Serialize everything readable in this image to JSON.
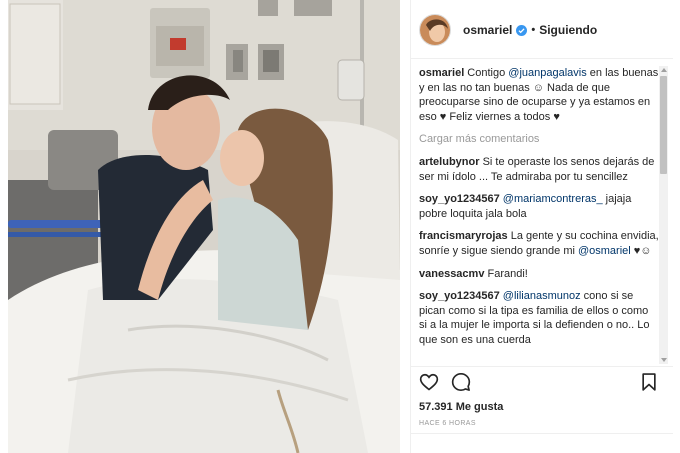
{
  "post": {
    "username": "osmariel",
    "verified": true,
    "separator": "•",
    "follow_state": "Siguiendo",
    "likes": "57.391 Me gusta",
    "time_ago": "HACE 6 HORAS"
  },
  "caption": {
    "user": "osmariel",
    "text_1": " Contigo ",
    "mention": "@juanpagalavis",
    "text_2": " en las buenas y en las no tan buenas ☺ Nada de que preocuparse sino de ocuparse y ya estamos en eso ♥ Feliz viernes a todos ♥"
  },
  "load_more": "Cargar más comentarios",
  "comments": [
    {
      "user": "artelubynor",
      "text": " Si te operaste los senos dejarás de ser mi ídolo ... Te admiraba por tu sencillez",
      "mention": "",
      "after": ""
    },
    {
      "user": "soy_yo1234567",
      "text": " ",
      "mention": "@mariamcontreras_",
      "after": " jajaja pobre loquita jala bola"
    },
    {
      "user": "francismaryrojas",
      "text": " La gente y su cochina envidia, sonríe y sigue siendo grande mi ",
      "mention": "@osmariel",
      "after": " ♥☺"
    },
    {
      "user": "vanessacmv",
      "text": " Farandi!",
      "mention": "",
      "after": ""
    },
    {
      "user": "soy_yo1234567",
      "text": " ",
      "mention": "@lilianasmunoz",
      "after": " cono si se pican como si la tipa es familia de ellos o como si a la mujer le importa si la defienden o no.. Lo que son es una cuerda"
    }
  ],
  "icons": {
    "like": "heart-icon",
    "comment": "comment-icon",
    "save": "bookmark-icon",
    "verified": "verified-badge-icon"
  },
  "colors": {
    "verified": "#3897f0",
    "mention": "#003569",
    "muted": "#999999"
  }
}
